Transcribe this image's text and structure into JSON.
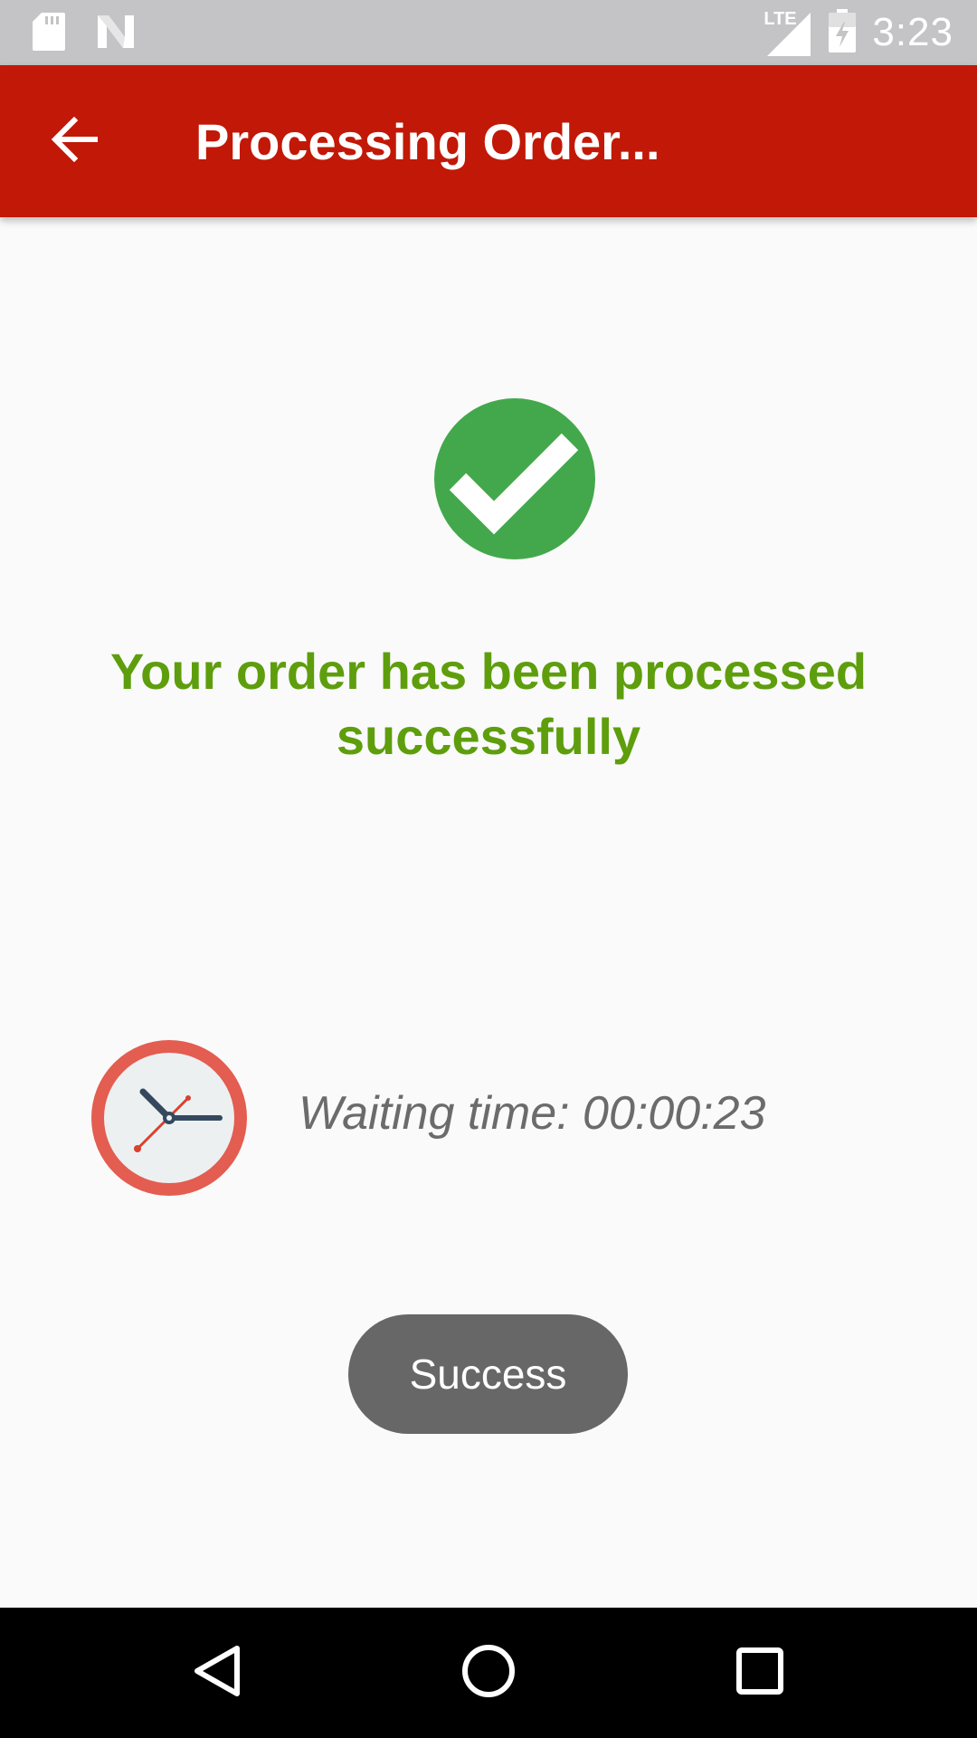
{
  "status_bar": {
    "time": "3:23",
    "network_label": "LTE",
    "icons": [
      "sd-card-icon",
      "n-notification-icon",
      "lte-signal-icon",
      "battery-charging-icon"
    ]
  },
  "app_bar": {
    "title": "Processing Order...",
    "back_icon": "arrow-back-icon",
    "color": "#c21807"
  },
  "main": {
    "status_icon": "check-circle-icon",
    "status_color": "#43a84b",
    "message": "Your order has been processed successfully",
    "message_color": "#5e9e0d",
    "waiting_icon": "clock-icon",
    "waiting_text": "Waiting time: 00:00:23",
    "button_label": "Success"
  },
  "nav_bar": {
    "icons": [
      "nav-back-icon",
      "nav-home-icon",
      "nav-recents-icon"
    ]
  }
}
